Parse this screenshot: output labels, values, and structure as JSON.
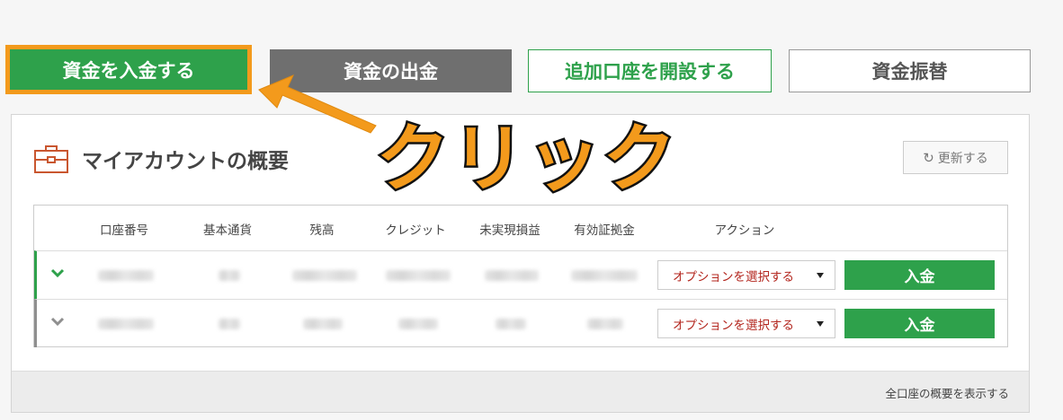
{
  "top_buttons": {
    "deposit": "資金を入金する",
    "withdraw": "資金の出金",
    "open_account": "追加口座を開設する",
    "transfer": "資金振替"
  },
  "panel": {
    "title": "マイアカウントの概要",
    "refresh_label": "更新する",
    "footer_link": "全口座の概要を表示する"
  },
  "table": {
    "headers": [
      "口座番号",
      "基本通貨",
      "残高",
      "クレジット",
      "未実現損益",
      "有効証拠金",
      "アクション"
    ],
    "rows": [
      {
        "select_label": "オプションを選択する",
        "deposit_label": "入金"
      },
      {
        "select_label": "オプションを選択する",
        "deposit_label": "入金"
      }
    ]
  },
  "annotation": {
    "text": "クリック"
  },
  "colors": {
    "green": "#2ea14b",
    "orange": "#f39a1c",
    "gray_button": "#6f6f6f",
    "red_text": "#b3261e"
  }
}
